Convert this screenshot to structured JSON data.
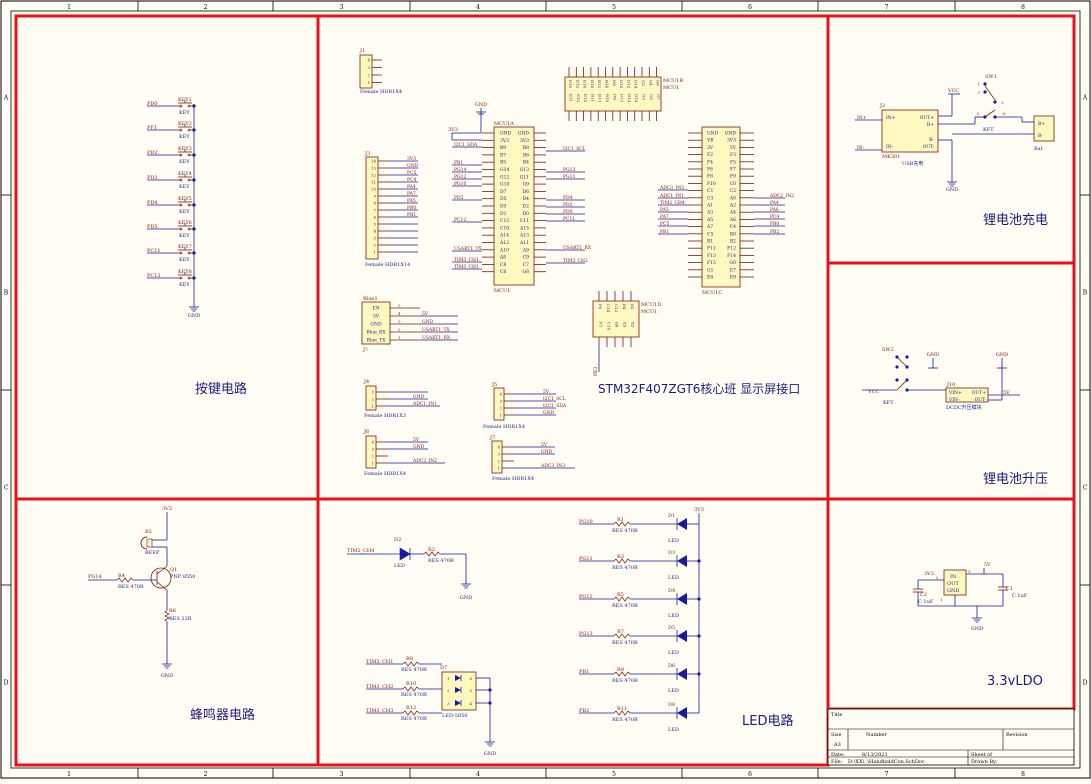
{
  "border": {
    "cols": [
      "1",
      "2",
      "3",
      "4",
      "5",
      "6",
      "7",
      "8"
    ],
    "rows": [
      "A",
      "B",
      "C",
      "D"
    ]
  },
  "sections": {
    "keys": "按键电路",
    "core": "STM32F407ZGT6核心班 显示屏接口",
    "charge": "锂电池充电",
    "boost": "锂电池升压",
    "beep": "蜂鸣器电路",
    "led": "LED电路",
    "ldo": "3.3vLDO"
  },
  "keys": {
    "nets": [
      "PD0",
      "PF1",
      "PD2",
      "PD3",
      "PD4",
      "PD5",
      "PC11",
      "PC12"
    ],
    "designators": [
      "KEY1",
      "KEY2",
      "KEY3",
      "KEY4",
      "KEY5",
      "KEY6",
      "KEY7",
      "KEY8"
    ],
    "value": "KEY",
    "gnd": "GND"
  },
  "headers": {
    "j1": {
      "ref": "J1",
      "name": "Female HDR1X4",
      "pins": [
        "4",
        "3",
        "2",
        "1"
      ]
    },
    "j3": {
      "ref": "J3",
      "name": "Female HDR1X14",
      "pins": [
        "14",
        "13",
        "12",
        "11",
        "10",
        "9",
        "8",
        "7",
        "6",
        "5",
        "4",
        "3",
        "2",
        "1"
      ],
      "nets": [
        "3V3",
        "GND",
        "PC5",
        "PC4",
        "PA4",
        "PA7",
        "PA5",
        "PB0",
        "PB1"
      ]
    },
    "blue": {
      "ref": "Blue1",
      "des": "J?",
      "pins": [
        "EN",
        "5V",
        "GND",
        "Blue_RX",
        "Blue_TX"
      ],
      "nums": [
        "5",
        "4",
        "3",
        "2",
        "1"
      ],
      "nets": [
        "5V",
        "GND",
        "USART1_TX",
        "USART1_RX"
      ]
    },
    "j4": {
      "ref": "J4",
      "name": "Female HDR1X3",
      "pins": [
        "3",
        "2",
        "1"
      ],
      "nets": [
        "GND",
        "ADC1_IN1"
      ]
    },
    "j6": {
      "ref": "J6",
      "name": "Female HDR1X4",
      "pins": [
        "4",
        "3",
        "2",
        "1"
      ],
      "nets": [
        "5V",
        "GND",
        "ADC2_IN2"
      ]
    },
    "j5": {
      "ref": "J5",
      "name": "Female HDR1X4",
      "pins": [
        "4",
        "3",
        "2",
        "1"
      ],
      "nets": [
        "5V",
        "I2C1_SCL",
        "I2C1_SDA",
        "GND"
      ]
    },
    "j7": {
      "ref": "J7",
      "name": "Female HDR1X4",
      "pins": [
        "4",
        "3",
        "2",
        "1"
      ],
      "nets": [
        "5V",
        "GND",
        "ADC3_IN3"
      ]
    }
  },
  "mcu": {
    "a": {
      "ref": "MCU1A",
      "des": "MCU1",
      "left": [
        "GND",
        "3V3",
        "B9",
        "B7",
        "B5",
        "G14",
        "G12",
        "G10",
        "D7",
        "D5",
        "D3",
        "D1",
        "C12",
        "C10",
        "A14",
        "A12",
        "A10",
        "A8",
        "C8",
        "C6"
      ],
      "right": [
        "GND",
        "3V3",
        "B8",
        "B6",
        "B4",
        "G13",
        "G11",
        "G9",
        "D6",
        "D4",
        "D2",
        "D0",
        "C11",
        "A15",
        "A13",
        "A11",
        "A9",
        "C9",
        "C7",
        "G8"
      ],
      "gnd": "GND",
      "p3v3": "3V3",
      "netsL": [
        "I2C1_SDA",
        "PB1",
        "PG14",
        "PG12",
        "PG10",
        "PD5",
        "PC12",
        "USART1_TX",
        "TIM3_CH1",
        "TIM3_CH1"
      ],
      "netsR": [
        "I2C1_SCL",
        "PG13",
        "PG11",
        "PD4",
        "PD2",
        "PD0",
        "PC11",
        "USART1_RX",
        "TIM3_CH2"
      ]
    },
    "b": {
      "ref": "MCU1B",
      "des": "MCU1",
      "pins": [
        "E10",
        "E12",
        "E14",
        "B10",
        "B12",
        "B14",
        "D8",
        "D10",
        "D12",
        "D14",
        "G2",
        "G4",
        "G6"
      ],
      "pins2": [
        "E11",
        "E13",
        "E15",
        "B11",
        "B13",
        "B15",
        "D9",
        "D11",
        "D13",
        "D15",
        "G3",
        "G5",
        "G7"
      ]
    },
    "c": {
      "ref": "MCU1C",
      "des": "MCU1",
      "left": [
        "GND",
        "VB",
        "3V",
        "F2",
        "F4",
        "F6",
        "F8",
        "F10",
        "C1",
        "C3",
        "A1",
        "A3",
        "A5",
        "A7",
        "C5",
        "B1",
        "F11",
        "F13",
        "F15",
        "G1",
        "E8"
      ],
      "right": [
        "GND",
        "3V3",
        "5V",
        "F3",
        "F5",
        "F7",
        "F9",
        "C0",
        "C2",
        "A0",
        "A2",
        "A4",
        "A6",
        "C4",
        "B0",
        "B2",
        "F12",
        "F14",
        "G0",
        "E7",
        "E9"
      ],
      "netsL": [
        "ADC3_IN3",
        "ADC1_IN1",
        "TIM2_CH4",
        "PA5",
        "PA7",
        "PC5",
        "PB1"
      ],
      "netsR": [
        "ADC2_IN2",
        "PA4",
        "PA6",
        "PC4",
        "PB0",
        "PB2"
      ]
    },
    "d": {
      "ref": "MCU1D",
      "des": "MCU1",
      "pins": [
        "F0",
        "C14",
        "C13",
        "E4",
        "E2"
      ],
      "pins2": [
        "F1",
        "C15",
        "E6",
        "E5",
        "E3"
      ],
      "net": "PE3"
    }
  },
  "charge": {
    "module": "MK301",
    "label": "USB充电",
    "u": "J2",
    "pins": [
      "IN+",
      "IN-"
    ],
    "out": [
      "OUT+",
      "B+",
      "B-",
      "OUT-"
    ],
    "vcc": "VCC",
    "sw": "SW1",
    "swlbl": "KFT",
    "bat": "Bat",
    "bplus": "B+",
    "bminus": "B-",
    "gnd": "GND",
    "in1": "IN+",
    "in2": "IN-"
  },
  "boost": {
    "sw": "SW2",
    "swlbl": "KFT",
    "vcc": "VCC",
    "u": "J10",
    "pins": [
      "VIN+",
      "VIN-"
    ],
    "outs": [
      "OUT+",
      "OUT-"
    ],
    "label": "DCDC升压模块",
    "out": "5V",
    "gnd": "GND"
  },
  "beep": {
    "p3v3": "3V3",
    "b": "B2",
    "bname": "BEEP",
    "q": "Q1",
    "qname": "PNP 8550",
    "r4": "R4",
    "r4v": "RES 470R",
    "r6": "R6",
    "r6v": "RES 22R",
    "net": "PG14",
    "gnd": "GND"
  },
  "led": {
    "d2": "D2",
    "d2n": "LED",
    "r2": "R2",
    "r2v": "RES 470R",
    "net2": "TIM2_CH4",
    "gnd": "GND",
    "rgb": {
      "ref": "D7",
      "name": "LED-5050",
      "nets": [
        "TIM3_CH1",
        "TIM3_CH2",
        "TIM3_CH3"
      ],
      "rs": [
        "R8",
        "R10",
        "R12"
      ],
      "rv": "RES 470R",
      "pins": [
        "1",
        "2",
        "3",
        "4",
        "5",
        "6"
      ]
    },
    "rows": [
      {
        "net": "PG10",
        "r": "R1",
        "d": "D1"
      },
      {
        "net": "PG11",
        "r": "R3",
        "d": "D3"
      },
      {
        "net": "PG12",
        "r": "R5",
        "d": "D4"
      },
      {
        "net": "PG13",
        "r": "R7",
        "d": "D5"
      },
      {
        "net": "PB1",
        "r": "R9",
        "d": "D6"
      },
      {
        "net": "PB2",
        "r": "R11",
        "d": "D8"
      }
    ],
    "rv": "RES 470R",
    "dn": "LED",
    "p3v3": "3V3"
  },
  "ldo": {
    "u": "U?",
    "in": "IN",
    "out": "OUT",
    "gnd": "GND",
    "c2": "C2",
    "c2v": "C 1uF",
    "c1": "C1",
    "c1v": "C 1uF",
    "p3v3": "3V3",
    "v5": "5V",
    "pins": [
      "3",
      "2",
      "1"
    ],
    "g": "GND"
  },
  "title": {
    "title": "Title",
    "size": "Size",
    "sizev": "A3",
    "number": "Number",
    "revision": "Revision",
    "date": "Date:",
    "datev": "8/13/2021",
    "sheet": "Sheet  of",
    "file": "File:",
    "filev": "D:\\XX\\..\\HandheldCon.SchDoc",
    "drawn": "Drawn By:"
  },
  "colors": {
    "frame": "#e8111b",
    "wire": "#1a1aa0",
    "part": "#7a1a10",
    "text": "#1a1a8a",
    "netlabel": "#8a1010",
    "border": "#000000",
    "paper": "#fffdf4"
  }
}
